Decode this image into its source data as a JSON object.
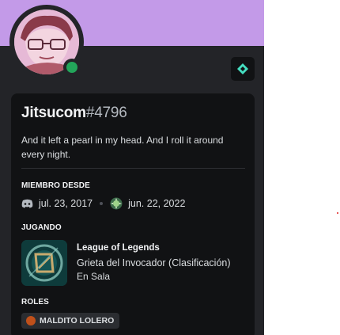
{
  "profile": {
    "username": "Jitsucom",
    "discriminator": "#4796",
    "status": "online",
    "bio": "And it left a pearl in my head. And I roll it around every night.",
    "colors": {
      "banner": "#c39ae8",
      "card": "#111214",
      "status_online": "#23a55a"
    }
  },
  "member_since": {
    "heading": "MIEMBRO DESDE",
    "discord_date": "jul. 23, 2017",
    "server_date": "jun. 22, 2022"
  },
  "playing": {
    "heading": "JUGANDO",
    "game": "League of Legends",
    "details": "Grieta del Invocador (Clasificación)",
    "state": "En Sala"
  },
  "roles": {
    "heading": "ROLES",
    "items": [
      {
        "name": "MALDITO LOLERO",
        "color": "#c0501a"
      }
    ]
  },
  "icons": {
    "badge": "hypesquad-balance-icon",
    "discord": "discord-logo-icon",
    "server": "server-icon",
    "game": "league-of-legends-icon"
  }
}
